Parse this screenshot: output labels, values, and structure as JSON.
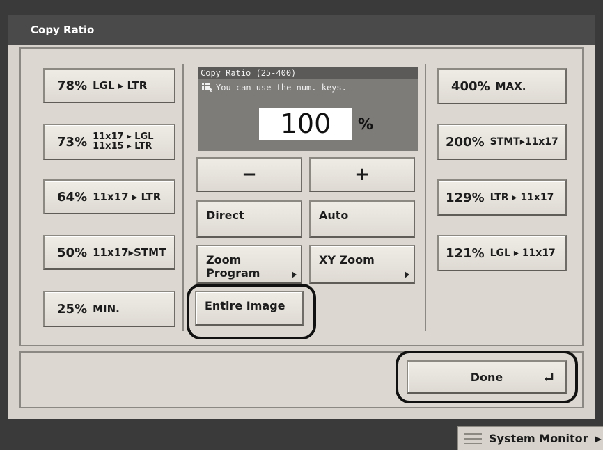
{
  "window": {
    "title": "Copy Ratio"
  },
  "reduce_presets": [
    {
      "percent": "78%",
      "desc_lines": [
        "LGL ▸ LTR"
      ]
    },
    {
      "percent": "73%",
      "desc_lines": [
        "11x17 ▸ LGL",
        "11x15 ▸ LTR"
      ]
    },
    {
      "percent": "64%",
      "desc_lines": [
        "11x17 ▸ LTR"
      ]
    },
    {
      "percent": "50%",
      "desc_lines": [
        "11x17▸STMT"
      ]
    },
    {
      "percent": "25%",
      "desc_lines": [
        "MIN."
      ]
    }
  ],
  "enlarge_presets": [
    {
      "percent": "400%",
      "desc_lines": [
        "MAX."
      ]
    },
    {
      "percent": "200%",
      "desc_lines": [
        "STMT▸11x17"
      ]
    },
    {
      "percent": "129%",
      "desc_lines": [
        "LTR ▸ 11x17"
      ]
    },
    {
      "percent": "121%",
      "desc_lines": [
        "LGL ▸ 11x17"
      ]
    }
  ],
  "ratio_display": {
    "header": "Copy Ratio (25-400)",
    "hint": "You can use the num. keys.",
    "value": "100",
    "unit": "%"
  },
  "controls": {
    "minus": "−",
    "plus": "+",
    "direct": "Direct",
    "auto": "Auto",
    "zoom_program": "Zoom\nProgram",
    "xy_zoom": "XY Zoom",
    "entire_image": "Entire Image"
  },
  "footer": {
    "done": "Done",
    "system_monitor": "System Monitor"
  },
  "colors": {
    "title_bar": "#4b4a4a",
    "panel": "#dcd8d1",
    "ratio_box": "#7e7c79",
    "highlight_ring": "#111111"
  },
  "highlighted": [
    "Entire Image",
    "Done"
  ]
}
